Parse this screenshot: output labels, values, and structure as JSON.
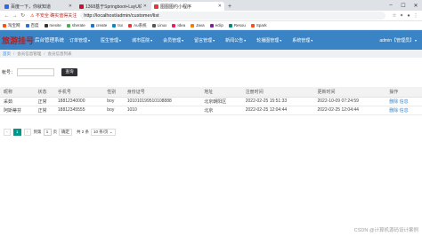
{
  "browser": {
    "tabs": [
      {
        "label": "百度一下，你就知道",
        "active": false,
        "color": "#2e6be6"
      },
      {
        "label": "1368基于Springboot+LayUI的...",
        "active": false,
        "color": "#c8102e"
      },
      {
        "label": "图图图约小程序",
        "active": true,
        "color": "#e53935"
      }
    ],
    "new_tab": "+",
    "address": {
      "security_label": "⚠ 不安全",
      "security_text": "确实值得关注",
      "url": "http://localhost/admin/customer/list"
    },
    "bookmarks": [
      {
        "label": "淘宝网",
        "color": "#ff5000"
      },
      {
        "label": "百度",
        "color": "#2e6be6"
      },
      {
        "label": "mexite",
        "color": "#333333"
      },
      {
        "label": "sherate",
        "color": "#4caf50"
      },
      {
        "label": "create",
        "color": "#1976d2"
      },
      {
        "label": "tsx",
        "color": "#0288d1"
      },
      {
        "label": "Au系统",
        "color": "#e53935"
      },
      {
        "label": "Linux",
        "color": "#555555"
      },
      {
        "label": "Idea",
        "color": "#e91e63"
      },
      {
        "label": "Java",
        "color": "#f57c00"
      },
      {
        "label": "eclip",
        "color": "#7b1fa2"
      },
      {
        "label": "Resou",
        "color": "#00897b"
      },
      {
        "label": "Spark",
        "color": "#f4511e"
      }
    ]
  },
  "app": {
    "logo_main": "旅游挂号",
    "logo_sub": "后台管理系统",
    "nav": [
      "订单管理",
      "医生管理",
      "城市医院",
      "会员管理",
      "留言管理",
      "新闻公告",
      "轮播图管理",
      "系统管理"
    ],
    "admin_label": "admin【管理员】",
    "colors": {
      "header": "#3a84c5",
      "pager_current": "#009688",
      "search_button": "#2d2f33"
    }
  },
  "breadcrumb": {
    "home": "首页",
    "level1": "会员信息管理",
    "level2": "会员信息列表"
  },
  "search": {
    "label": "帐号：",
    "placeholder": "",
    "button": "查询"
  },
  "table": {
    "headers": [
      "昵称",
      "状态",
      "手机号",
      "性别",
      "身份证号",
      "地址",
      "注册时间",
      "更新时间",
      "操作"
    ],
    "rows": [
      [
        "采茹",
        "正常",
        "18812340000",
        "boy",
        "101010199510108888",
        "北京朝阳区",
        "2022-02-25 15:51:33",
        "2022-10-09 07:24:59",
        "删除 信息"
      ],
      [
        "阿斯蒂芬",
        "正常",
        "18812345555",
        "boy",
        "1010",
        "北京",
        "2022-02-25 12:04:44",
        "2022-02-25 12:04:44",
        "删除 信息"
      ]
    ]
  },
  "pagination": {
    "current": "1",
    "goto_prefix": "到第",
    "goto_value": "1",
    "goto_suffix": "页",
    "confirm": "确定",
    "total": "共 2 条",
    "page_size": "10 条/页 ⌄"
  },
  "watermark": "CSDN @计算机源码设计案例"
}
